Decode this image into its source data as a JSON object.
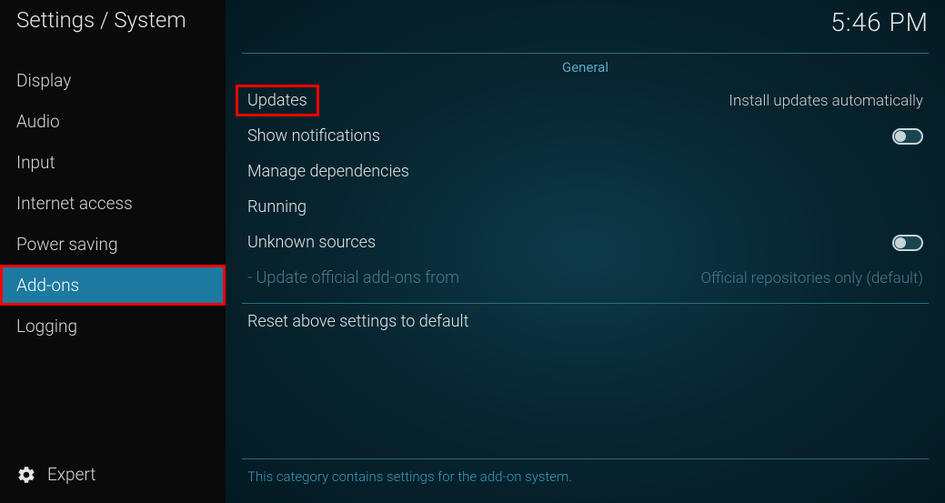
{
  "header": {
    "breadcrumb": "Settings / System",
    "clock": "5:46 PM"
  },
  "sidebar": {
    "items": [
      {
        "label": "Display"
      },
      {
        "label": "Audio"
      },
      {
        "label": "Input"
      },
      {
        "label": "Internet access"
      },
      {
        "label": "Power saving"
      },
      {
        "label": "Add-ons",
        "selected": true,
        "highlighted": true
      },
      {
        "label": "Logging"
      }
    ],
    "level_label": "Expert"
  },
  "main": {
    "section_title": "General",
    "rows": [
      {
        "label": "Updates",
        "value": "Install updates automatically",
        "highlighted": true
      },
      {
        "label": "Show notifications",
        "toggle": false
      },
      {
        "label": "Manage dependencies"
      },
      {
        "label": "Running"
      },
      {
        "label": "Unknown sources",
        "toggle": false
      },
      {
        "label": "- Update official add-ons from",
        "value": "Official repositories only (default)",
        "disabled": true
      },
      {
        "label": "Reset above settings to default"
      }
    ],
    "footer": "This category contains settings for the add-on system."
  }
}
